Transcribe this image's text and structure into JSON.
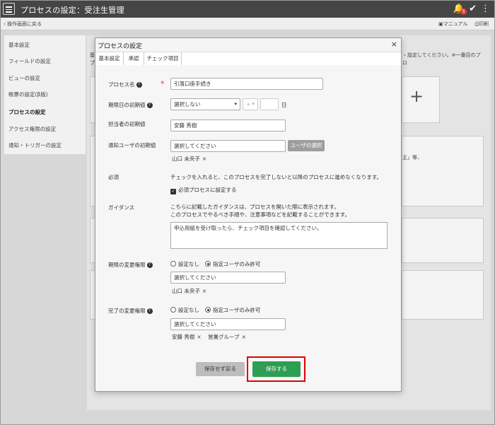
{
  "app": {
    "title": "プロセスの設定：受注生管理",
    "badge": "5",
    "icons": [
      "hamburger-icon",
      "bell-icon",
      "check-icon",
      "kebab-icon"
    ]
  },
  "subbar": {
    "back": "操作画面に戻る",
    "manual": "マニュアル",
    "print": "印刷"
  },
  "sidebar": {
    "items": [
      {
        "label": "基本設定"
      },
      {
        "label": "フィールドの設定"
      },
      {
        "label": "ビューの設定"
      },
      {
        "label": "帳票の設定(β版)"
      },
      {
        "label": "プロセスの設定"
      },
      {
        "label": "アクセス権限の設定"
      },
      {
        "label": "通知・トリガーの設定"
      }
    ],
    "active_index": 4
  },
  "background": {
    "tab_fragment": "基",
    "left_fragment": "プ",
    "right_note": "・設定してください。※一番目のプ",
    "right_note2": "ロ",
    "right_note3": "主」等、",
    "plus": "+"
  },
  "modal": {
    "title": "プロセスの設定",
    "close": "×",
    "tabs": [
      "基本設定",
      "承認",
      "チェック項目"
    ],
    "process_name": {
      "label": "プロセス名",
      "value": "引落口座手続き",
      "required": "*"
    },
    "deadline": {
      "label": "期限日の初期値",
      "select": "選択しない",
      "sign": "+",
      "unit": "日"
    },
    "assignee": {
      "label": "担当者の初期値",
      "value": "安藤 秀樹"
    },
    "notify": {
      "label": "通知ユーザの初期値",
      "placeholder": "選択してください",
      "button": "ユーザの選択",
      "chips": [
        "山口 未央子"
      ]
    },
    "required_section": {
      "label": "必須",
      "desc": "チェックを入れると、このプロセスを完了しないと以降のプロセスに進めなくなります。",
      "checkbox": "必須プロセスに設定する"
    },
    "guidance": {
      "label": "ガイダンス",
      "desc1": "こちらに記載したガイダンスは、プロセスを開いた際に表示されます。",
      "desc2": "このプロセスでやるべき手順や、注意事項などを記載することができます。",
      "value": "申込用紙を受け取ったら、チェック項目を確認してください。"
    },
    "deadline_perm": {
      "label": "期限の変更権限",
      "opt_none": "設定なし",
      "opt_user": "指定ユーザのみ許可",
      "placeholder": "選択してください",
      "chips": [
        "山口 未央子"
      ]
    },
    "complete_perm": {
      "label": "完了の変更権限",
      "opt_none": "設定なし",
      "opt_user": "指定ユーザのみ許可",
      "placeholder": "選択してください",
      "chips": [
        "安藤 秀樹",
        "営業グループ"
      ]
    },
    "cancel_button": "保存せず戻る",
    "save_button": "保存する"
  }
}
